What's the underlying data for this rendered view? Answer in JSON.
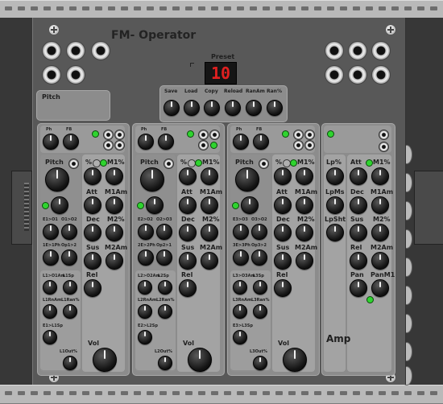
{
  "module": {
    "title": "FM- Operator"
  },
  "preset": {
    "label": "Preset",
    "value": "10"
  },
  "pitch_box": {
    "label": "Pitch"
  },
  "preset_buttons": [
    "Save",
    "Load",
    "Copy",
    "Reload",
    "RanAm",
    "Ran%"
  ],
  "operators": [
    {
      "ph": "Ph",
      "fb": "FB",
      "pitch": "Pitch",
      "pct": "%",
      "m1pct": "M1%",
      "att": "Att",
      "m1am": "M1Am",
      "dec": "Dec",
      "m2pct": "M2%",
      "sus": "Sus",
      "m2am": "M2Am",
      "rel": "Rel",
      "vol": "Vol",
      "routes": [
        "E1>O1",
        "O1>O2",
        "1E>1Ph",
        "Op1>2"
      ],
      "lfo": [
        "L1>O1Am",
        "L1Sp",
        "L1RnAm",
        "L1Ran%",
        "E1>L1Sp",
        "L1Out%"
      ]
    },
    {
      "ph": "Ph",
      "fb": "FB",
      "pitch": "Pitch",
      "pct": "%",
      "m1pct": "M1%",
      "att": "Att",
      "m1am": "M1Am",
      "dec": "Dec",
      "m2pct": "M2%",
      "sus": "Sus",
      "m2am": "M2Am",
      "rel": "Rel",
      "vol": "Vol",
      "routes": [
        "E2>O2",
        "O2>O3",
        "2E>2Ph",
        "Op2>1"
      ],
      "lfo": [
        "L2>O2Am",
        "L2Sp",
        "L2RnAm",
        "L2Ran%",
        "E2>L2Sp",
        "L2Out%"
      ]
    },
    {
      "ph": "Ph",
      "fb": "FB",
      "pitch": "Pitch",
      "pct": "%",
      "m1pct": "M1%",
      "att": "Att",
      "m1am": "M1Am",
      "dec": "Dec",
      "m2pct": "M2%",
      "sus": "Sus",
      "m2am": "M2Am",
      "rel": "Rel",
      "vol": "Vol",
      "routes": [
        "E3>O3",
        "O3>O2",
        "3E>3Ph",
        "Op3>2"
      ],
      "lfo": [
        "L3>O3Am",
        "L3Sp",
        "L3RnAm",
        "L3Ran%",
        "E3>L3Sp",
        "L3Out%"
      ]
    }
  ],
  "amp": {
    "lp_pct": "Lp%",
    "lp_ms": "LpMs",
    "lp_sht": "LpSht",
    "att": "Att",
    "m1pct": "M1%",
    "dec": "Dec",
    "m1am": "M1Am",
    "sus": "Sus",
    "m2pct": "M2%",
    "rel": "Rel",
    "m2am": "M2Am",
    "pan": "Pan",
    "pan_m1": "PanM1",
    "title": "Amp"
  },
  "colors": {
    "panel": "#585858",
    "led": "#2fd42f",
    "display": "#e02020"
  }
}
